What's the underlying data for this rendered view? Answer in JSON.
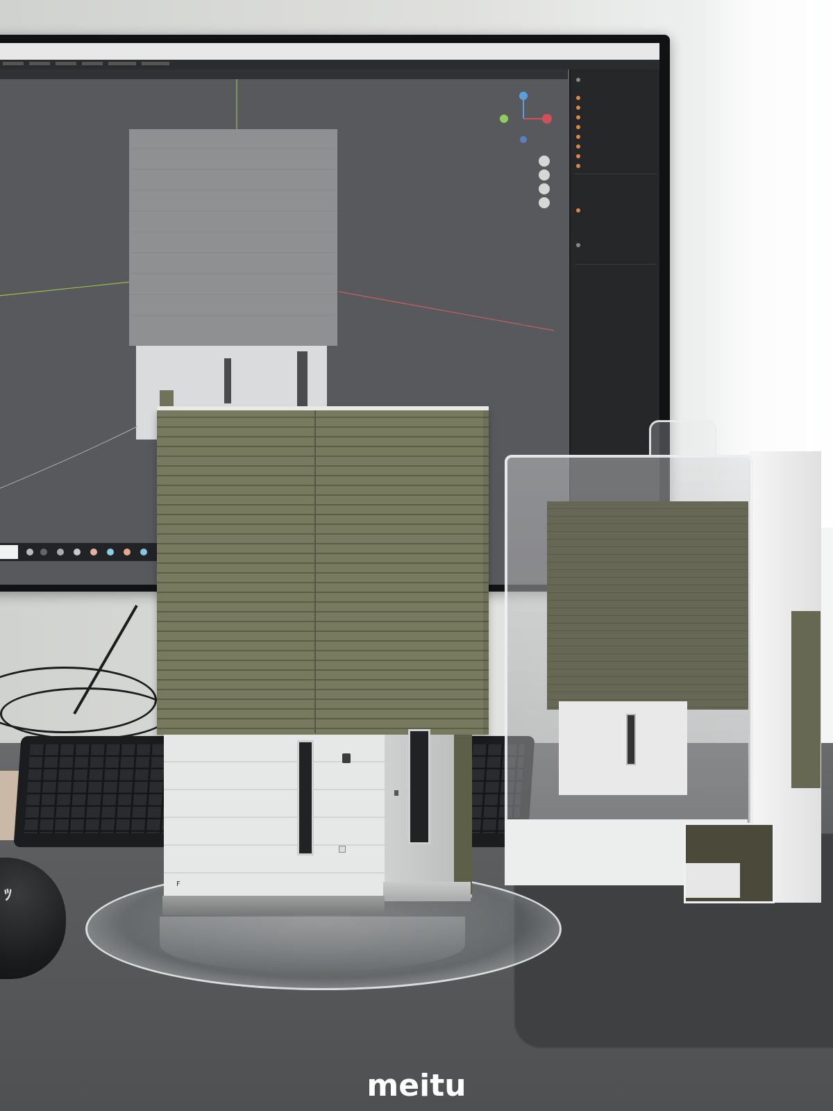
{
  "screen": {
    "title_text": "",
    "outliner_rows": [
      "",
      "",
      "",
      "",
      "",
      "",
      "",
      "",
      "",
      "",
      ""
    ]
  },
  "model": {
    "house_number": "F"
  },
  "mouse": {
    "glyph": "ﾂ"
  },
  "watermark": {
    "text": "meitu"
  },
  "colors": {
    "siding_green": "#6f7257",
    "lower_white": "#e6e8e7",
    "desk": "#5c5d5e",
    "monitor_bezel": "#111214",
    "viewport_gray": "#58595c"
  }
}
